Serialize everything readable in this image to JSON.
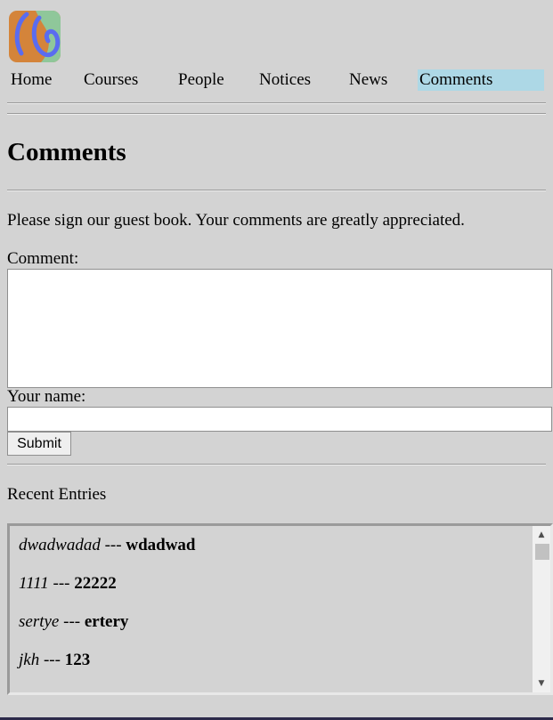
{
  "logo": {
    "icon": "site-logo-icon",
    "colors": [
      "#d4843a",
      "#8fc79a",
      "#5a6cf0"
    ]
  },
  "nav": {
    "items": [
      {
        "label": "Home",
        "active": false
      },
      {
        "label": "Courses",
        "active": false
      },
      {
        "label": "People",
        "active": false
      },
      {
        "label": "Notices",
        "active": false
      },
      {
        "label": "News",
        "active": false
      },
      {
        "label": "Comments",
        "active": true
      }
    ],
    "active_color": "#add8e6"
  },
  "page": {
    "title": "Comments",
    "intro": "Please sign our guest book. Your comments are greatly appreciated."
  },
  "form": {
    "comment_label": "Comment:",
    "comment_value": "",
    "name_label": "Your name:",
    "name_value": "",
    "submit_label": "Submit"
  },
  "recent": {
    "title": "Recent Entries",
    "entries": [
      {
        "author": "dwadwadad",
        "separator": " --- ",
        "comment": "wdadwad"
      },
      {
        "author": "1111",
        "separator": " --- ",
        "comment": "22222"
      },
      {
        "author": "sertye",
        "separator": " --- ",
        "comment": "ertery"
      },
      {
        "author": "jkh",
        "separator": " --- ",
        "comment": "123"
      }
    ],
    "scroll_up_icon": "▲",
    "scroll_down_icon": "▼"
  },
  "theme": {
    "background": "#d3d3d3",
    "bottom_bar": "#2c2a4a"
  }
}
